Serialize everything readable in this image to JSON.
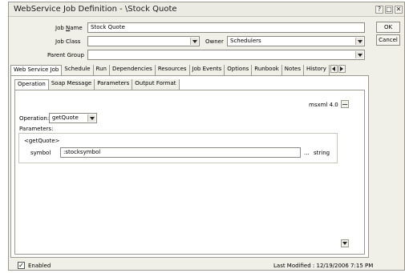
{
  "window": {
    "title": "WebService Job Definition - \\Stock Quote",
    "help_btn": "?",
    "max_btn": "□",
    "close_btn": "✕"
  },
  "form": {
    "job_name_label_pre": "Job ",
    "job_name_label_u": "N",
    "job_name_label_post": "ame",
    "job_name_value": "Stock Quote",
    "job_class_label": "Job Class",
    "job_class_value": "",
    "owner_label": "Owner",
    "owner_value": "Schedulers",
    "parent_group_label": "Parent Group",
    "parent_group_value": ""
  },
  "buttons": {
    "ok": "OK",
    "cancel": "Cancel"
  },
  "main_tabs": [
    {
      "label": "Web Service Job",
      "active": true
    },
    {
      "label": "Schedule"
    },
    {
      "label": "Run"
    },
    {
      "label": "Dependencies"
    },
    {
      "label": "Resources"
    },
    {
      "label": "Job Events"
    },
    {
      "label": "Options"
    },
    {
      "label": "Runbook"
    },
    {
      "label": "Notes"
    },
    {
      "label": "History"
    }
  ],
  "sub_tabs": [
    {
      "label": "Operation",
      "active": true
    },
    {
      "label": "Soap Message"
    },
    {
      "label": "Parameters"
    },
    {
      "label": "Output Format"
    }
  ],
  "operation": {
    "msxml_label": "msxml 4.0",
    "operation_label": "Operation:",
    "operation_value": "getQuote",
    "parameters_label": "Parameters:",
    "group_title": "<getQuote>",
    "param_name": "symbol",
    "param_value": ":stocksymbol",
    "browse_label": "...",
    "param_type": "string"
  },
  "footer": {
    "enabled_label": "Enabled",
    "enabled_checked": true,
    "check_mark": "✓",
    "last_modified": "Last Modified : 12/19/2006 7:15 PM"
  }
}
